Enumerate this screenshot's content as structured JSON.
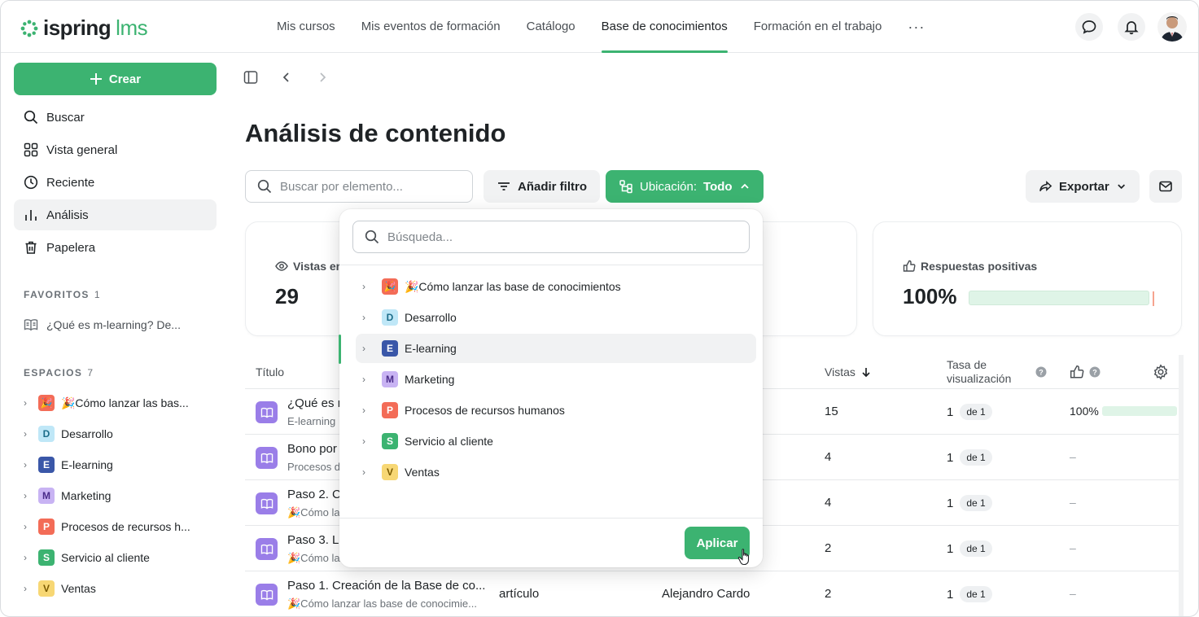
{
  "header": {
    "logo_text": "ispring",
    "logo_suffix": "lms",
    "nav": [
      {
        "label": "Mis cursos"
      },
      {
        "label": "Mis eventos de formación"
      },
      {
        "label": "Catálogo"
      },
      {
        "label": "Base de conocimientos"
      },
      {
        "label": "Formación en el trabajo"
      }
    ],
    "more_label": "···",
    "active_nav": "Base de conocimientos"
  },
  "sidebar": {
    "create_label": "Crear",
    "items": [
      {
        "label": "Buscar",
        "icon": "search-icon"
      },
      {
        "label": "Vista general",
        "icon": "grid-icon"
      },
      {
        "label": "Reciente",
        "icon": "clock-icon"
      },
      {
        "label": "Análisis",
        "icon": "bar-chart-icon"
      },
      {
        "label": "Papelera",
        "icon": "trash-icon"
      }
    ],
    "favorites_title": "FAVORITOS",
    "favorites_count": "1",
    "favorites": [
      {
        "label": "¿Qué es m-learning? De..."
      }
    ],
    "spaces_title": "ESPACIOS",
    "spaces_count": "7",
    "spaces": [
      {
        "badge": "🎉",
        "label": "🎉Cómo lanzar las bas..."
      },
      {
        "badge": "D",
        "label": "Desarrollo"
      },
      {
        "badge": "E",
        "label": "E-learning"
      },
      {
        "badge": "M",
        "label": "Marketing"
      },
      {
        "badge": "P",
        "label": "Procesos de recursos h..."
      },
      {
        "badge": "S",
        "label": "Servicio al cliente"
      },
      {
        "badge": "V",
        "label": "Ventas"
      }
    ]
  },
  "main": {
    "title": "Análisis de contenido",
    "search_placeholder": "Buscar por elemento...",
    "add_filter_label": "Añadir filtro",
    "location_label": "Ubicación:",
    "location_value": "Todo",
    "export_label": "Exportar",
    "cards": {
      "views_title": "Vistas en",
      "views_value": "29",
      "positive_title": "Respuestas positivas",
      "positive_value": "100%",
      "positive_fraction": 1.0
    },
    "table": {
      "headers": {
        "title": "Título",
        "views": "Vistas",
        "rate": "Tasa de visualización"
      },
      "rows": [
        {
          "title": "¿Qué es m",
          "sub": "E-learning",
          "type": "",
          "author": "",
          "views": "15",
          "rate": "1",
          "rate_of": "de 1",
          "likes": "100%",
          "likes_fraction": 1.0
        },
        {
          "title": "Bono por",
          "sub": "Procesos d",
          "type": "",
          "author": "",
          "views": "4",
          "rate": "1",
          "rate_of": "de 1",
          "likes": "–"
        },
        {
          "title": "Paso 2. C",
          "sub": "🎉Cómo la",
          "type": "",
          "author": "",
          "views": "4",
          "rate": "1",
          "rate_of": "de 1",
          "likes": "–"
        },
        {
          "title": "Paso 3. L",
          "sub": "🎉Cómo la",
          "type": "",
          "author": "",
          "views": "2",
          "rate": "1",
          "rate_of": "de 1",
          "likes": "–"
        },
        {
          "title": "Paso 1. Creación de la Base de co...",
          "sub": "🎉Cómo lanzar las base de conocimie...",
          "type": "artículo",
          "author": "Alejandro Cardo",
          "views": "2",
          "rate": "1",
          "rate_of": "de 1",
          "likes": "–"
        }
      ]
    }
  },
  "dropdown": {
    "search_placeholder": "Búsqueda...",
    "items": [
      {
        "badge": "🎉",
        "label": "🎉Cómo lanzar las base de conocimientos"
      },
      {
        "badge": "D",
        "label": "Desarrollo"
      },
      {
        "badge": "E",
        "label": "E-learning"
      },
      {
        "badge": "M",
        "label": "Marketing"
      },
      {
        "badge": "P",
        "label": "Procesos de recursos humanos"
      },
      {
        "badge": "S",
        "label": "Servicio al cliente"
      },
      {
        "badge": "V",
        "label": "Ventas"
      }
    ],
    "selected": "E-learning",
    "apply_label": "Aplicar"
  },
  "colors": {
    "accent": "#3cb371",
    "progress": "#dff4e7"
  }
}
